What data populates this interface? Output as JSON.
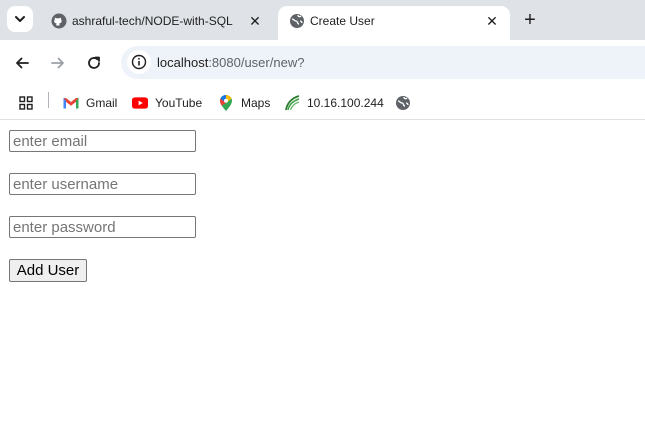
{
  "tabs": [
    {
      "label": "ashraful-tech/NODE-with-SQL",
      "active": false,
      "icon": "github-icon"
    },
    {
      "label": "Create User",
      "active": true,
      "icon": "globe-icon"
    }
  ],
  "address_bar": {
    "host": "localhost",
    "path": ":8080/user/new?"
  },
  "bookmarks": [
    {
      "label": "Gmail",
      "icon": "gmail-icon"
    },
    {
      "label": "YouTube",
      "icon": "youtube-icon"
    },
    {
      "label": "Maps",
      "icon": "maps-icon"
    },
    {
      "label": "10.16.100.244",
      "icon": "network-icon"
    },
    {
      "label": "",
      "icon": "globe-icon"
    }
  ],
  "form": {
    "email_placeholder": "enter email",
    "username_placeholder": "enter username",
    "password_placeholder": "enter password",
    "submit_label": "Add User"
  },
  "colors": {
    "tabstrip": "#dfe3e8",
    "omnibox": "#eef2f9",
    "youtube": "#ff0000",
    "gmail_red": "#ea4335"
  }
}
